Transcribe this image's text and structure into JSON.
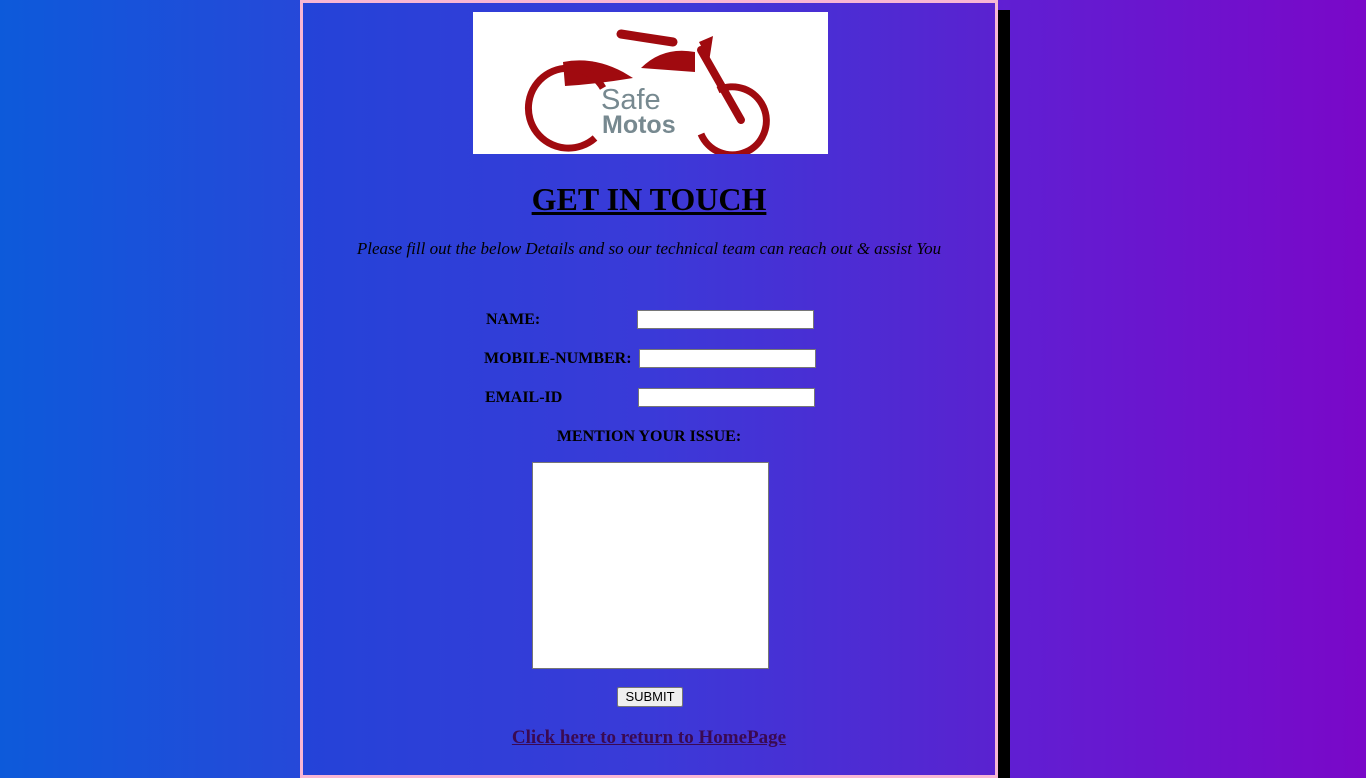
{
  "logo": {
    "icon": "motorcycle-logo-icon",
    "line1": "Safe",
    "line2": "Motos",
    "brand_color": "#a00a0f",
    "text_color": "#778990"
  },
  "heading": {
    "title": "GET IN TOUCH",
    "subtitle": "Please fill out the below Details and so our technical team can reach out & assist You"
  },
  "form": {
    "name_label": "NAME:",
    "name_value": "",
    "mobile_label": "MOBILE-NUMBER:",
    "mobile_value": "",
    "email_label": "EMAIL-ID",
    "email_value": "",
    "issue_label": "MENTION YOUR ISSUE:",
    "issue_value": "",
    "submit_label": "SUBMIT"
  },
  "links": {
    "home": "Click here to return to HomePage"
  },
  "colors": {
    "card_border": "#f8b6d4",
    "link": "#3a0a52"
  }
}
